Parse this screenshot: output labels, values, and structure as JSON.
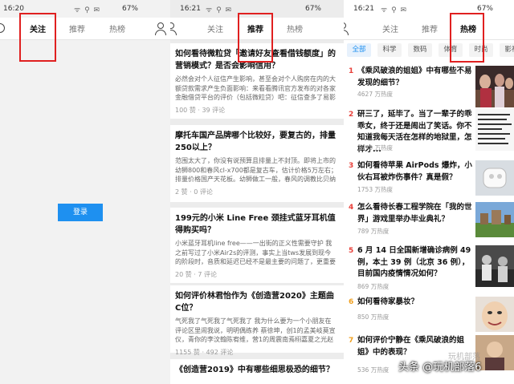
{
  "panel1": {
    "status": {
      "time": "16:20",
      "battery": "67%"
    },
    "tabs": {
      "follow": "关注",
      "recommend": "推荐",
      "hot": "热榜"
    },
    "login_button": "登录"
  },
  "panel2": {
    "status": {
      "time": "16:21",
      "battery": "67%"
    },
    "tabs": {
      "follow": "关注",
      "recommend": "推荐",
      "hot": "热榜"
    },
    "feed": [
      {
        "title": "如何看待微粒贷「邀请好友查看借钱额度」的营销模式？是否会影响信用？",
        "excerpt": "必然会对个人征信产生影响，甚至会对个人购房在内的大额贷款需求产生负面影响：来看看腾讯官方发布的对各家金融借贷平台的评价（包括微粒贷）吧：征信查多了易影响...",
        "meta": "100 赞 · 39 评论"
      },
      {
        "title": "摩托车国产品牌哪个比较好，要复古的，排量250以上？",
        "excerpt": "范围太大了，你没有说预算且排量上不封顶。即将上市的幼狮800和春风cl-x700都是复古车，估计价格5万左右；排量价格国产天花板。幼狮做工一般，春风的调教比贝纳利好",
        "meta": "2 赞 · 0 评论"
      },
      {
        "title": "199元的小米 Line Free 颈挂式蓝牙耳机值得购买吗？",
        "excerpt": "小米蓝牙耳机line free——一出街的正义性需要守护 我之前写过了小米Air2s的评测，事实上当tws发展到现今的阶段时，音质和延迟已经不是最主要的问题了，更重要的问题转向...",
        "meta": "20 赞 · 7 评论"
      },
      {
        "title": "如何评价林君怡作为《创造营2020》主题曲C位？",
        "excerpt": "气死我了气死我了气死我了 我为什么要为一个小朋友在评论区里闹我说，明明偶练养 蔡徐坤，创1的孟美岐莫宣仪，青你的李汶翰陈宥维，营1的周震南焉栩嘉夏之光赵磊 我要气死了",
        "meta": "1155 赞 · 492 评论"
      },
      {
        "title": "《创造营2019》中有哪些细思极恐的细节？",
        "excerpt": "",
        "meta": ""
      }
    ]
  },
  "panel3": {
    "status": {
      "time": "16:21",
      "battery": "67%"
    },
    "tabs": {
      "follow": "关注",
      "recommend": "推荐",
      "hot": "热榜"
    },
    "chips": [
      "全部",
      "科学",
      "数码",
      "体育",
      "时尚",
      "影视"
    ],
    "hot": [
      {
        "rank": "1",
        "title": "《乘风破浪的姐姐》中有哪些不易发现的细节？",
        "heat": "4627 万热度"
      },
      {
        "rank": "2",
        "title": "研三了，延毕了。当了一辈子的乖乖女，终于还是闹出了笑话。你不知道我每天活在怎样的地狱里，怎样才...",
        "heat": "1879 万热度"
      },
      {
        "rank": "3",
        "title": "如何看待苹果 AirPods 爆炸，小伙右耳被炸伤事件？真是假？",
        "heat": "1753 万热度"
      },
      {
        "rank": "4",
        "title": "怎么看待长春工程学院在「我的世界」游戏里举办毕业典礼？",
        "heat": "789 万热度"
      },
      {
        "rank": "5",
        "title": "6 月 14 日全国新增确诊病例 49 例，本土 39 例（北京 36 例），目前国内疫情情况如何？",
        "heat": "869 万热度"
      },
      {
        "rank": "6",
        "title": "如何看待家暴妆？",
        "heat": "850 万热度"
      },
      {
        "rank": "7",
        "title": "如何评价宁静在《乘风破浪的姐姐》中的表现？",
        "heat": "536 万热度"
      }
    ]
  },
  "watermark": "头条 @玩机部落6",
  "faint_text": "玩机部落"
}
